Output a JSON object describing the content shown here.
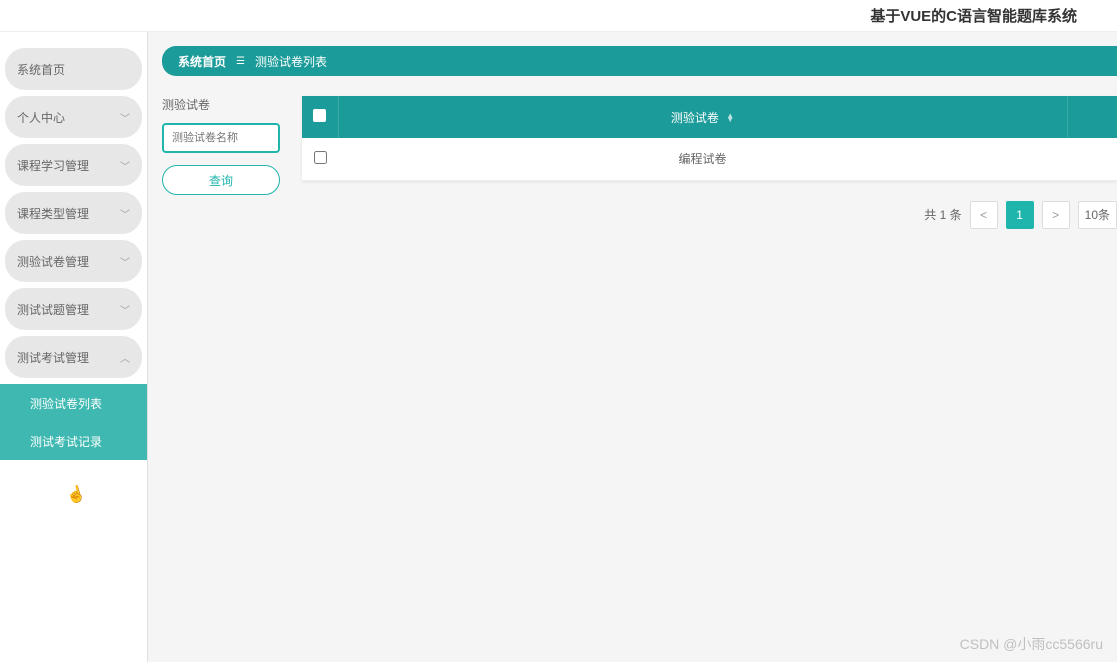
{
  "header": {
    "title": "基于VUE的C语言智能题库系统"
  },
  "sidebar": {
    "items": [
      {
        "label": "系统首页",
        "expandable": false
      },
      {
        "label": "个人中心",
        "expandable": true
      },
      {
        "label": "课程学习管理",
        "expandable": true
      },
      {
        "label": "课程类型管理",
        "expandable": true
      },
      {
        "label": "测验试卷管理",
        "expandable": true
      },
      {
        "label": "测试试题管理",
        "expandable": true
      },
      {
        "label": "测试考试管理",
        "expandable": true,
        "expanded": true,
        "children": [
          {
            "label": "测验试卷列表"
          },
          {
            "label": "测试考试记录"
          }
        ]
      }
    ]
  },
  "breadcrumb": {
    "home": "系统首页",
    "current": "测验试卷列表"
  },
  "search": {
    "label": "测验试卷",
    "placeholder": "测验试卷名称",
    "button": "查询"
  },
  "table": {
    "columns": [
      "",
      "测验试卷",
      ""
    ],
    "rows": [
      {
        "name": "编程试卷"
      }
    ]
  },
  "pagination": {
    "total_text": "共 1 条",
    "prev": "<",
    "pages": [
      "1"
    ],
    "next": ">",
    "page_size": "10条"
  },
  "watermark": "CSDN @小雨cc5566ru"
}
